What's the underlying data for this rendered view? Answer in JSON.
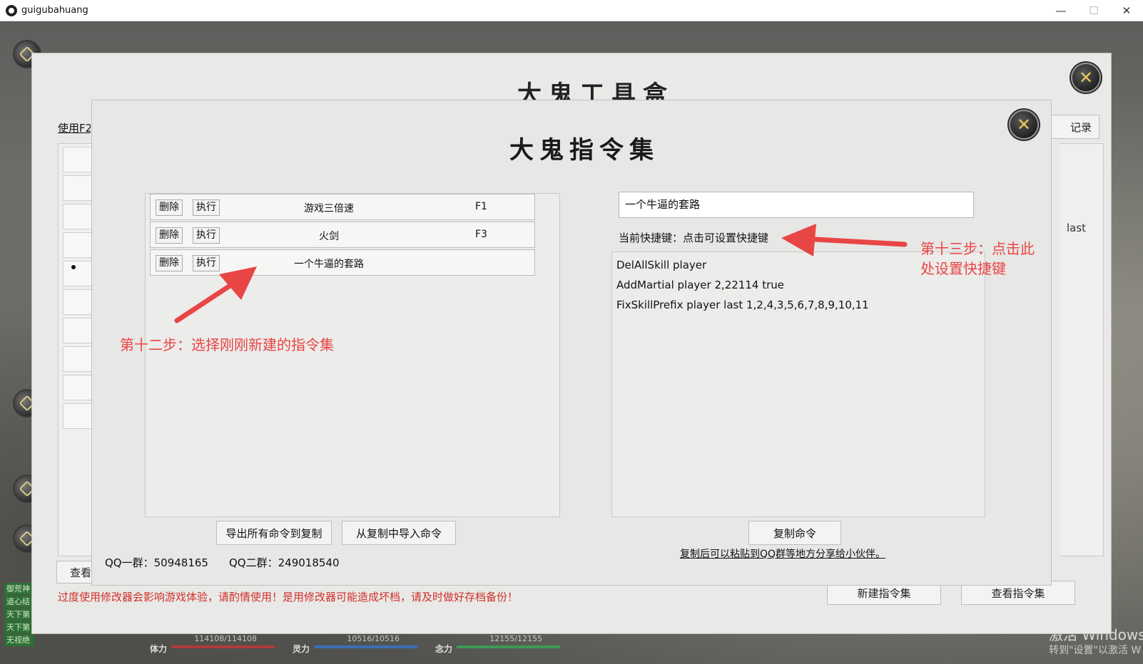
{
  "window": {
    "title": "guigubahuang",
    "minimize_glyph": "—",
    "maximize_glyph": "☐",
    "close_glyph": "✕"
  },
  "outer": {
    "title": "大鬼工具盒",
    "hint_partial": "使用F2",
    "record_button_partial": "记录",
    "last_partial": "last",
    "view_roles_button_partial": "查看所有角色",
    "new_set_button": "新建指令集",
    "view_set_button": "查看指令集",
    "warning": "过度使用修改器会影响游戏体验，请酌情使用！是用修改器可能造成坏档，请及时做好存档备份！"
  },
  "dialog": {
    "title": "大鬼指令集",
    "command_sets": [
      {
        "delete_label": "删除",
        "run_label": "执行",
        "name": "游戏三倍速",
        "hotkey": "F1"
      },
      {
        "delete_label": "删除",
        "run_label": "执行",
        "name": "火剑",
        "hotkey": "F3"
      },
      {
        "delete_label": "删除",
        "run_label": "执行",
        "name": "一个牛逼的套路",
        "hotkey": ""
      }
    ],
    "name_value": "一个牛逼的套路",
    "hotkey_label": "当前快捷键：点击可设置快捷键",
    "commands": [
      "DelAllSkill player",
      "AddMartial player 2,22114  true",
      "FixSkillPrefix player last 1,2,4,3,5,6,7,8,9,10,11"
    ],
    "export_button": "导出所有命令到复制",
    "import_button": "从复制中导入命令",
    "copy_button": "复制命令",
    "copy_hint": "复制后可以粘贴到QQ群等地方分享给小伙伴。",
    "qq1": "QQ一群：50948165",
    "qq2": "QQ二群：249018540"
  },
  "annotations": {
    "step12": "第十二步：选择刚刚新建的指令集",
    "step13_line1": "第十三步：点击此",
    "step13_line2": "处设置快捷键"
  },
  "side_tags": [
    "御荒神",
    "道心结",
    "天下第",
    "天下第",
    "无视绝"
  ],
  "stats": [
    {
      "label": "体力",
      "value": "114108/114108",
      "fill": 1.0,
      "color": "#b33a3a"
    },
    {
      "label": "灵力",
      "value": "10516/10516",
      "fill": 1.0,
      "color": "#3a6fb3"
    },
    {
      "label": "念力",
      "value": "12155/12155",
      "fill": 1.0,
      "color": "#3a9a55"
    }
  ],
  "activation_watermark": {
    "line1": "激活 Windows",
    "line2": "转到\"设置\"以激活 W"
  },
  "colors": {
    "annotation": "#e84545",
    "warning": "#d0302a",
    "close_orb_x": "#e9c65a"
  },
  "icons": {
    "app": "app-logo-icon",
    "close_orb": "close-x-icon",
    "arrow": "red-arrow-icon"
  }
}
